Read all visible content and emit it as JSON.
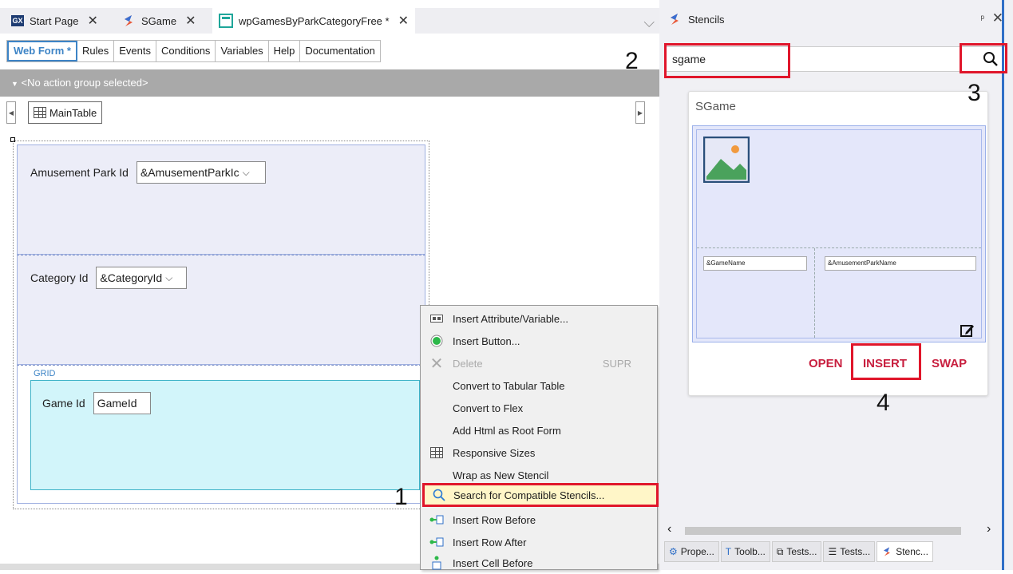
{
  "editor": {
    "tabs": [
      {
        "label": "Start Page",
        "icon": "gx-icon"
      },
      {
        "label": "SGame",
        "icon": "stencil-icon"
      },
      {
        "label": "wpGamesByParkCategoryFree *",
        "icon": "webpanel-icon"
      }
    ],
    "subtabs": [
      "Web Form *",
      "Rules",
      "Events",
      "Conditions",
      "Variables",
      "Help",
      "Documentation"
    ],
    "action_group": "<No action group selected>",
    "breadcrumb": "MainTable",
    "form": {
      "row1_label": "Amusement Park Id",
      "row1_value": "&AmusementParkIc",
      "row2_label": "Category Id",
      "row2_value": "&CategoryId",
      "grid_label": "GRID",
      "grid_field_label": "Game Id",
      "grid_field_value": "GameId"
    }
  },
  "context_menu": {
    "items": [
      {
        "label": "Insert Attribute/Variable...",
        "icon": "attribute-icon"
      },
      {
        "label": "Insert Button...",
        "icon": "button-icon"
      },
      {
        "label": "Delete",
        "icon": "delete-icon",
        "shortcut": "SUPR",
        "disabled": true
      },
      {
        "label": "Convert to Tabular Table",
        "icon": ""
      },
      {
        "label": "Convert to Flex",
        "icon": ""
      },
      {
        "label": "Add Html as Root Form",
        "icon": ""
      },
      {
        "label": "Responsive Sizes",
        "icon": "grid-icon"
      },
      {
        "label": "Wrap as New Stencil",
        "icon": ""
      },
      {
        "label": "Search for Compatible Stencils...",
        "icon": "search-icon",
        "highlighted": true
      },
      {
        "label": "Insert Row Before",
        "icon": "insert-row-icon"
      },
      {
        "label": "Insert Row After",
        "icon": "insert-row-icon"
      },
      {
        "label": "Insert Cell Before",
        "icon": "insert-cell-icon"
      }
    ]
  },
  "stencils": {
    "title": "Stencils",
    "search_value": "sgame",
    "card_title": "SGame",
    "preview_field_1": "&GameName",
    "preview_field_2": "&AmusementParkName",
    "actions": {
      "open": "OPEN",
      "insert": "INSERT",
      "swap": "SWAP"
    },
    "bottom_tabs": [
      "Prope...",
      "Toolb...",
      "Tests...",
      "Tests...",
      "Stenc..."
    ]
  },
  "annotations": {
    "n1": "1",
    "n2": "2",
    "n3": "3",
    "n4": "4"
  },
  "colors": {
    "highlight_red": "#e0162b",
    "action_red": "#c81f3f",
    "accent_blue": "#3d84c6"
  }
}
